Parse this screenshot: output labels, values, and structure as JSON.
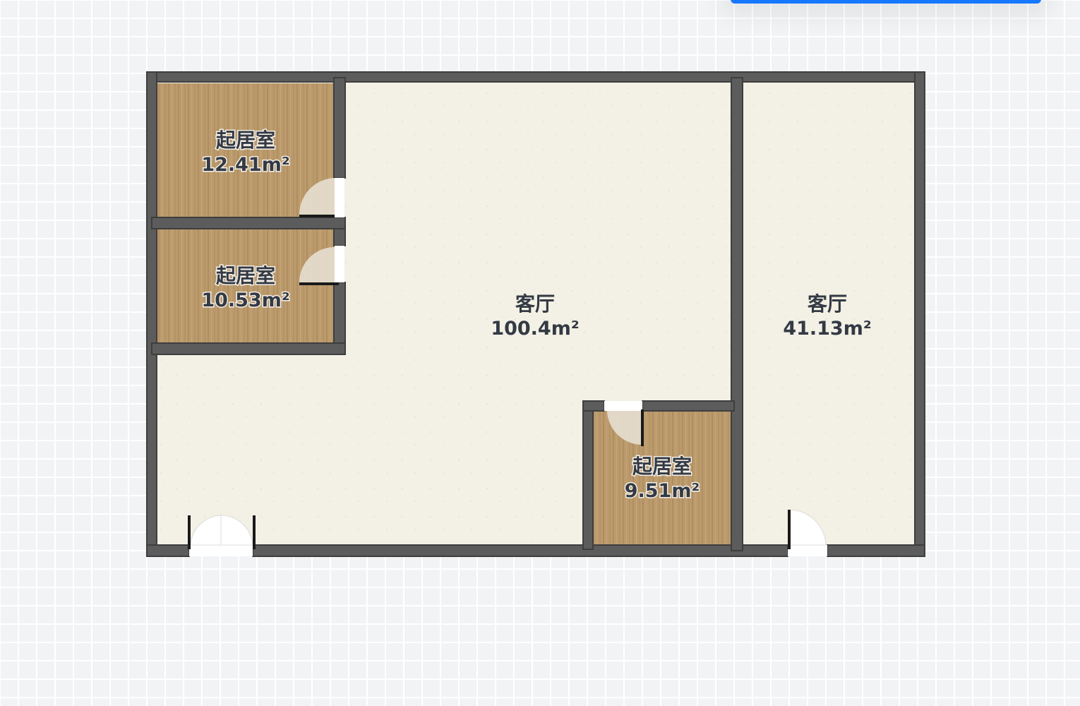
{
  "rooms": {
    "bedroom_top": {
      "name": "起居室",
      "area": "12.41m²"
    },
    "bedroom_mid": {
      "name": "起居室",
      "area": "10.53m²"
    },
    "living_main": {
      "name": "客厅",
      "area": "100.4m²"
    },
    "bedroom_small": {
      "name": "起居室",
      "area": "9.51m²"
    },
    "living_right": {
      "name": "客厅",
      "area": "41.13m²"
    }
  },
  "colors": {
    "wall": "#5a5a5a",
    "floor_light": "#f2efe4",
    "floor_wood": "#b9976a",
    "accent": "#1677ff",
    "grid_bg": "#f2f3f5"
  }
}
